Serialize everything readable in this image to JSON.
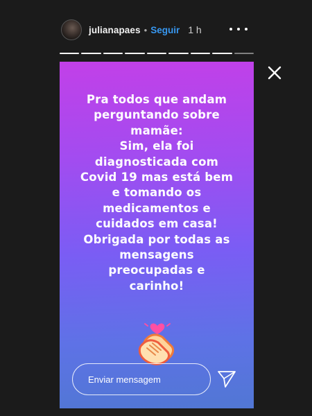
{
  "header": {
    "username": "julianapaes",
    "separator": "•",
    "follow_label": "Seguir",
    "time": "1 h"
  },
  "progress": {
    "segments": 9,
    "current_index": 8
  },
  "story": {
    "background_colors": [
      "#c240e8",
      "#7a5df4",
      "#5177d4"
    ],
    "text": "Pra todos que andam\nperguntando sobre\nmamãe:\nSim, ela foi\ndiagnosticada com\nCovid 19 mas está bem\ne tomando os\nmedicamentos e\ncuidados em casa!\nObrigada por todas as\nmensagens\npreocupadas e\ncarinho!",
    "sticker": "clapping-hands-heart-sticker"
  },
  "reply": {
    "placeholder": "Enviar mensagem"
  },
  "icons": {
    "more": "more-options-icon",
    "close": "close-icon",
    "send": "send-icon"
  }
}
